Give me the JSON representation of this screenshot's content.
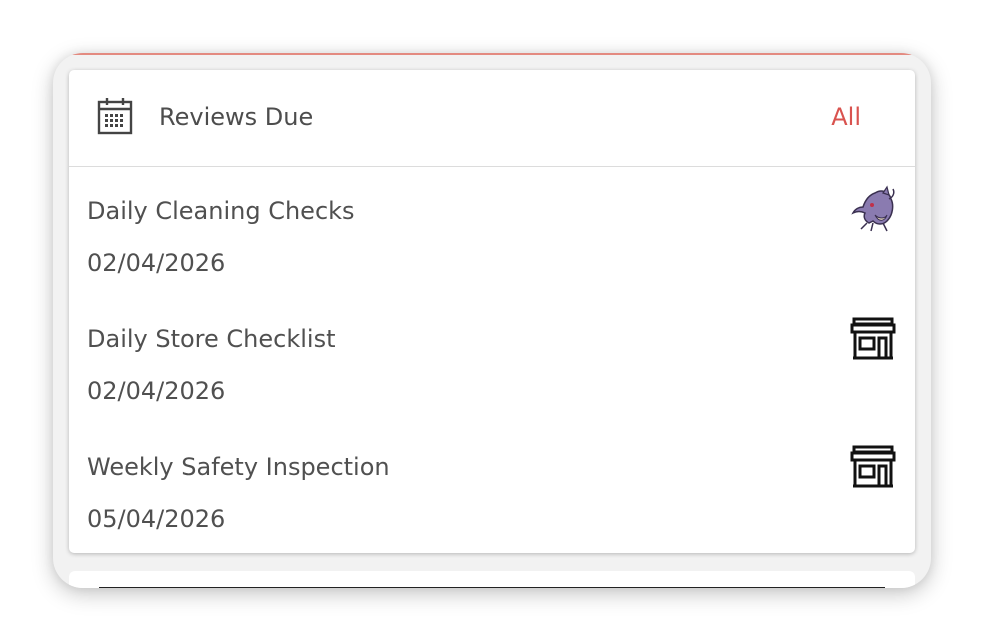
{
  "header": {
    "icon": "calendar-icon",
    "title": "Reviews Due",
    "link_label": "All"
  },
  "colors": {
    "accent": "#d9534f",
    "text": "#505050",
    "frame_background": "#f2f2f2",
    "card_background": "#ffffff"
  },
  "reviews": [
    {
      "title": "Daily Cleaning Checks",
      "date": "02/04/2026",
      "icon": "avatar-creature-icon"
    },
    {
      "title": "Daily Store Checklist",
      "date": "02/04/2026",
      "icon": "store-icon"
    },
    {
      "title": "Weekly Safety Inspection",
      "date": "05/04/2026",
      "icon": "store-icon"
    }
  ]
}
